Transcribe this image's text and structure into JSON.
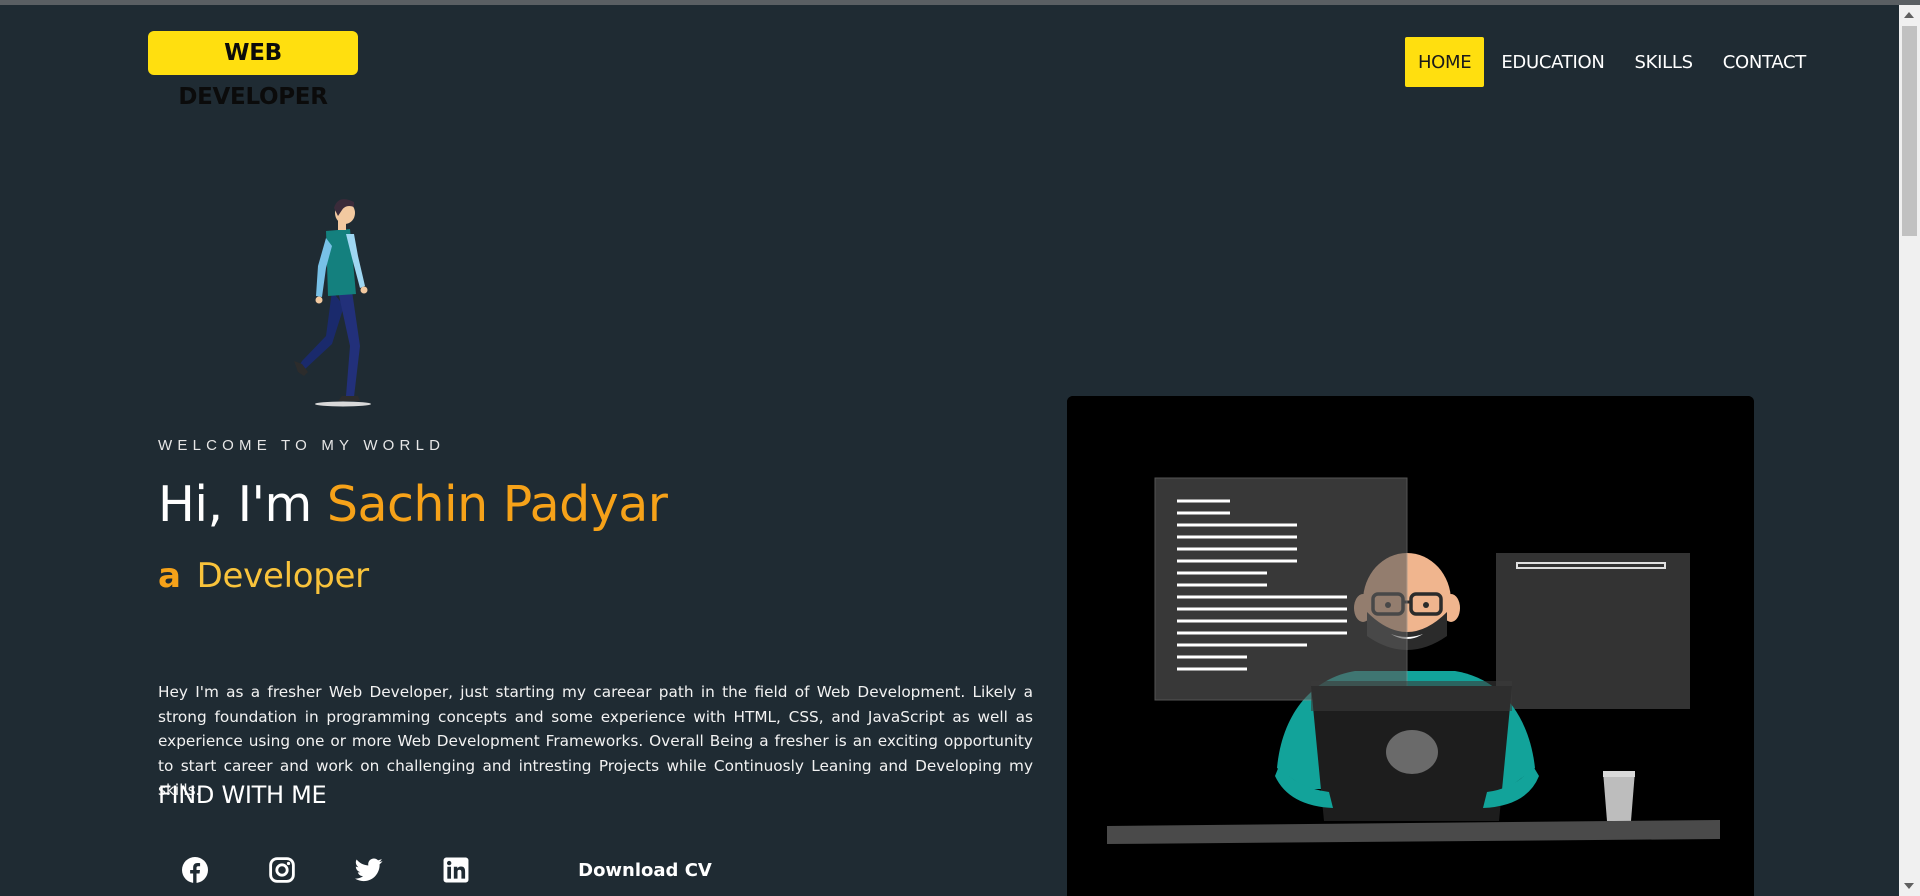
{
  "header": {
    "logo": "WEB DEVELOPER",
    "nav": [
      {
        "label": "HOME",
        "active": true
      },
      {
        "label": "EDUCATION",
        "active": false
      },
      {
        "label": "SKILLS",
        "active": false
      },
      {
        "label": "CONTACT",
        "active": false
      }
    ]
  },
  "hero": {
    "welcome": "WELCOME TO MY WORLD",
    "greeting": "Hi, I'm",
    "name": "Sachin Padyar",
    "role_prefix": "a",
    "role": "Developer",
    "bio": "Hey I'm as a fresher Web Developer, just starting my careear path in the field of Web Development. Likely a strong foundation in programming concepts and some experience with HTML, CSS, and JavaScript as well as experience using one or more Web Development Frameworks. Overall Being a fresher is an exciting opportunity to start career and work on challenging and intresting Projects while Continuosly Leaning and Developing my skills.",
    "find_heading": "FIND WITH ME",
    "socials": [
      {
        "name": "facebook-icon"
      },
      {
        "name": "instagram-icon"
      },
      {
        "name": "twitter-icon"
      },
      {
        "name": "linkedin-icon"
      }
    ],
    "download_label": "Download CV"
  },
  "colors": {
    "background": "#1f2b33",
    "accent": "#ffdf0f",
    "highlight": "#f6a219",
    "role": "#f9c33b"
  }
}
